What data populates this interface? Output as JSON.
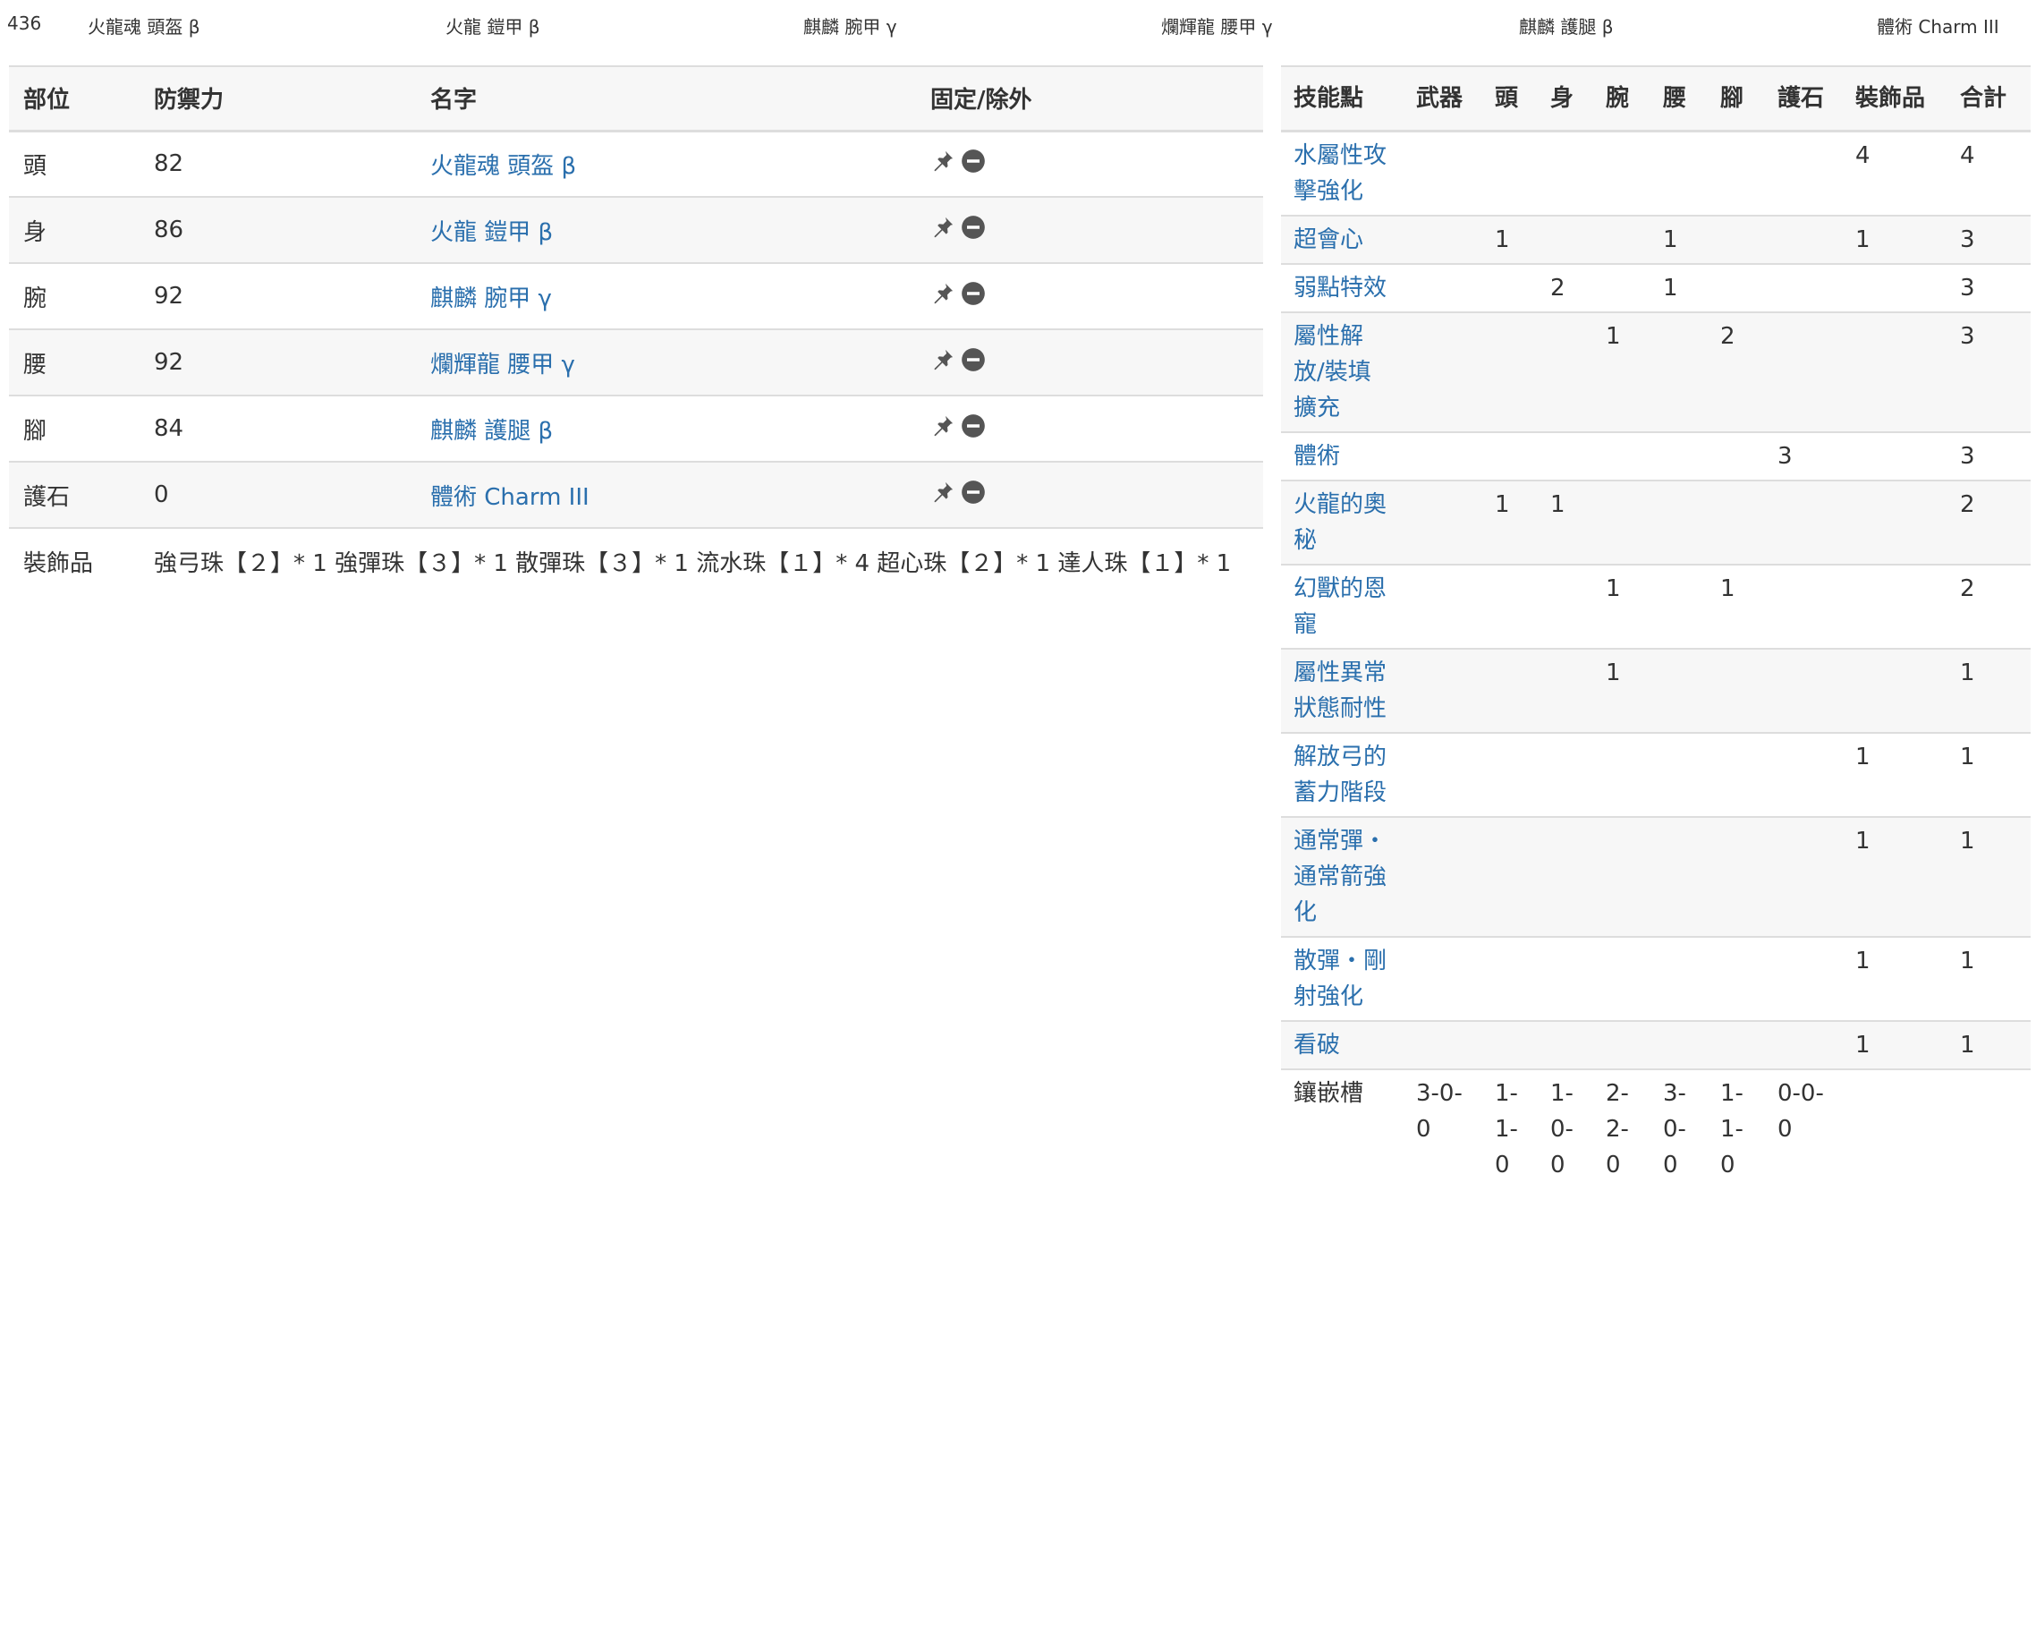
{
  "summary": {
    "defense": "436",
    "head": "火龍魂 頭盔 β",
    "body": "火龍 鎧甲 β",
    "arm": "麒麟 腕甲 γ",
    "waist": "爛輝龍 腰甲 γ",
    "leg": "麒麟 護腿 β",
    "charm": "體術 Charm III"
  },
  "equip": {
    "headers": {
      "part": "部位",
      "defense": "防禦力",
      "name": "名字",
      "fix": "固定/除外"
    },
    "rows": [
      {
        "part": "頭",
        "defense": "82",
        "name": "火龍魂 頭盔 β"
      },
      {
        "part": "身",
        "defense": "86",
        "name": "火龍 鎧甲 β"
      },
      {
        "part": "腕",
        "defense": "92",
        "name": "麒麟 腕甲 γ"
      },
      {
        "part": "腰",
        "defense": "92",
        "name": "爛輝龍 腰甲 γ"
      },
      {
        "part": "腳",
        "defense": "84",
        "name": "麒麟 護腿 β"
      },
      {
        "part": "護石",
        "defense": "0",
        "name": "體術 Charm III"
      }
    ],
    "decorations": {
      "label": "裝飾品",
      "value": "強弓珠【２】* 1 強彈珠【３】* 1 散彈珠【３】* 1 流水珠【１】* 4 超心珠【２】* 1 達人珠【１】* 1"
    },
    "icons": {
      "fix": "pin-icon",
      "exclude": "minus-circle-icon"
    }
  },
  "skills": {
    "headers": [
      "技能點",
      "武器",
      "頭",
      "身",
      "腕",
      "腰",
      "腳",
      "護石",
      "裝飾品",
      "合計"
    ],
    "rows": [
      {
        "name": "水屬性攻擊強化",
        "cells": [
          "",
          "",
          "",
          "",
          "",
          "",
          "",
          "4",
          "4"
        ]
      },
      {
        "name": "超會心",
        "cells": [
          "",
          "1",
          "",
          "",
          "1",
          "",
          "",
          "1",
          "3"
        ]
      },
      {
        "name": "弱點特效",
        "cells": [
          "",
          "",
          "2",
          "",
          "1",
          "",
          "",
          "",
          "3"
        ]
      },
      {
        "name": "屬性解放/裝填擴充",
        "cells": [
          "",
          "",
          "",
          "1",
          "",
          "2",
          "",
          "",
          "3"
        ]
      },
      {
        "name": "體術",
        "cells": [
          "",
          "",
          "",
          "",
          "",
          "",
          "3",
          "",
          "3"
        ]
      },
      {
        "name": "火龍的奧秘",
        "cells": [
          "",
          "1",
          "1",
          "",
          "",
          "",
          "",
          "",
          "2"
        ]
      },
      {
        "name": "幻獸的恩寵",
        "cells": [
          "",
          "",
          "",
          "1",
          "",
          "1",
          "",
          "",
          "2"
        ]
      },
      {
        "name": "屬性異常狀態耐性",
        "cells": [
          "",
          "",
          "",
          "1",
          "",
          "",
          "",
          "",
          "1"
        ]
      },
      {
        "name": "解放弓的蓄力階段",
        "cells": [
          "",
          "",
          "",
          "",
          "",
          "",
          "",
          "1",
          "1"
        ]
      },
      {
        "name": "通常彈・通常箭強化",
        "cells": [
          "",
          "",
          "",
          "",
          "",
          "",
          "",
          "1",
          "1"
        ]
      },
      {
        "name": "散彈・剛射強化",
        "cells": [
          "",
          "",
          "",
          "",
          "",
          "",
          "",
          "1",
          "1"
        ]
      },
      {
        "name": "看破",
        "cells": [
          "",
          "",
          "",
          "",
          "",
          "",
          "",
          "1",
          "1"
        ]
      }
    ],
    "slots": {
      "label": "鑲嵌槽",
      "cells": [
        "3-0-0",
        "1-1-0",
        "1-0-0",
        "2-2-0",
        "3-0-0",
        "1-1-0",
        "0-0-0",
        "",
        ""
      ]
    }
  },
  "colors": {
    "link": "#2a6fad",
    "stripe": "#f7f7f7",
    "border": "#dddddd",
    "icon": "#555555"
  }
}
